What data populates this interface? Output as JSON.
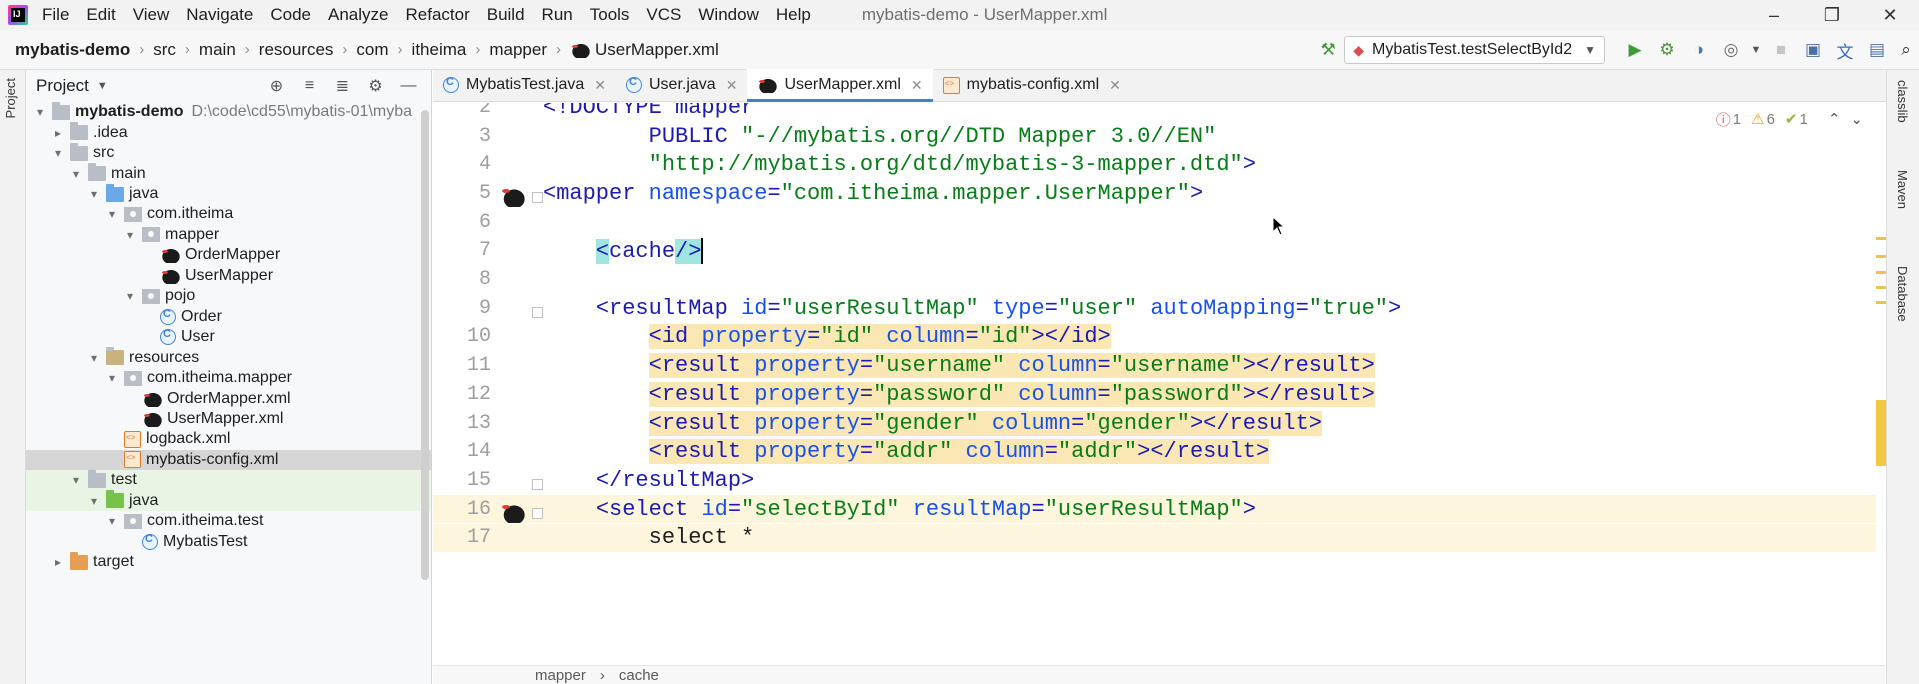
{
  "menubar": {
    "logo_text": "IJ",
    "items": [
      "File",
      "Edit",
      "View",
      "Navigate",
      "Code",
      "Analyze",
      "Refactor",
      "Build",
      "Run",
      "Tools",
      "VCS",
      "Window",
      "Help"
    ],
    "window_title": "mybatis-demo - UserMapper.xml"
  },
  "navbar": {
    "breadcrumb": [
      "mybatis-demo",
      "src",
      "main",
      "resources",
      "com",
      "itheima",
      "mapper",
      "UserMapper.xml"
    ],
    "run_config": "MybatisTest.testSelectById2"
  },
  "left_stripe": {
    "label": "Project"
  },
  "project_panel": {
    "title": "Project",
    "tree": [
      {
        "label": "mybatis-demo",
        "extra": "D:\\code\\cd55\\mybatis-01\\myba",
        "arrow": "▾",
        "icon": "folder",
        "indent": 0,
        "bold": true
      },
      {
        "label": ".idea",
        "arrow": "▸",
        "icon": "folder",
        "indent": 1
      },
      {
        "label": "src",
        "arrow": "▾",
        "icon": "folder",
        "indent": 1
      },
      {
        "label": "main",
        "arrow": "▾",
        "icon": "folder",
        "indent": 2
      },
      {
        "label": "java",
        "arrow": "▾",
        "icon": "folder-blue",
        "indent": 3
      },
      {
        "label": "com.itheima",
        "arrow": "▾",
        "icon": "pkg",
        "indent": 4
      },
      {
        "label": "mapper",
        "arrow": "▾",
        "icon": "pkg",
        "indent": 5
      },
      {
        "label": "OrderMapper",
        "arrow": "",
        "icon": "bird",
        "indent": 6
      },
      {
        "label": "UserMapper",
        "arrow": "",
        "icon": "bird",
        "indent": 6
      },
      {
        "label": "pojo",
        "arrow": "▾",
        "icon": "pkg",
        "indent": 5
      },
      {
        "label": "Order",
        "arrow": "",
        "icon": "cls",
        "indent": 6
      },
      {
        "label": "User",
        "arrow": "",
        "icon": "cls",
        "indent": 6
      },
      {
        "label": "resources",
        "arrow": "▾",
        "icon": "res",
        "indent": 3
      },
      {
        "label": "com.itheima.mapper",
        "arrow": "▾",
        "icon": "pkg",
        "indent": 4
      },
      {
        "label": "OrderMapper.xml",
        "arrow": "",
        "icon": "bird",
        "indent": 5
      },
      {
        "label": "UserMapper.xml",
        "arrow": "",
        "icon": "bird",
        "indent": 5
      },
      {
        "label": "logback.xml",
        "arrow": "",
        "icon": "xml",
        "indent": 4
      },
      {
        "label": "mybatis-config.xml",
        "arrow": "",
        "icon": "xml",
        "indent": 4,
        "selected": true
      },
      {
        "label": "test",
        "arrow": "▾",
        "icon": "folder",
        "indent": 2,
        "test": true
      },
      {
        "label": "java",
        "arrow": "▾",
        "icon": "folder-green",
        "indent": 3,
        "test": true
      },
      {
        "label": "com.itheima.test",
        "arrow": "▾",
        "icon": "pkg",
        "indent": 4
      },
      {
        "label": "MybatisTest",
        "arrow": "",
        "icon": "cls",
        "indent": 5
      },
      {
        "label": "target",
        "arrow": "▸",
        "icon": "folder-orange",
        "indent": 1
      }
    ]
  },
  "tabs": [
    {
      "label": "MybatisTest.java",
      "icon": "cls",
      "active": false
    },
    {
      "label": "User.java",
      "icon": "cls",
      "active": false
    },
    {
      "label": "UserMapper.xml",
      "icon": "bird",
      "active": true
    },
    {
      "label": "mybatis-config.xml",
      "icon": "xml",
      "active": false
    }
  ],
  "inspections": {
    "errors": "1",
    "warnings": "6",
    "weak": "1"
  },
  "code_lines": [
    {
      "n": "2",
      "indent": "",
      "tokens": [
        {
          "c": "t-tag",
          "t": "<!DOCTYPE mapper"
        }
      ]
    },
    {
      "n": "3",
      "indent": "        ",
      "tokens": [
        {
          "c": "t-tag",
          "t": "PUBLIC "
        },
        {
          "c": "t-val",
          "t": "\"-//mybatis.org//DTD Mapper 3.0//EN\""
        }
      ]
    },
    {
      "n": "4",
      "indent": "        ",
      "tokens": [
        {
          "c": "t-val",
          "t": "\"http://mybatis.org/dtd/mybatis-3-mapper.dtd\""
        },
        {
          "c": "t-tag",
          "t": ">"
        }
      ]
    },
    {
      "n": "5",
      "indent": "",
      "gutter": "bird",
      "fold": true,
      "tokens": [
        {
          "c": "t-tag",
          "t": "<mapper "
        },
        {
          "c": "t-attr",
          "t": "namespace"
        },
        {
          "c": "t-tag",
          "t": "="
        },
        {
          "c": "t-val",
          "t": "\"com.itheima.mapper.UserMapper\""
        },
        {
          "c": "t-tag",
          "t": ">"
        }
      ]
    },
    {
      "n": "6",
      "indent": "",
      "tokens": []
    },
    {
      "n": "7",
      "indent": "    ",
      "tokens": [
        {
          "c": "t-tag t-cache",
          "t": "<"
        },
        {
          "c": "t-tag",
          "t": "cache"
        },
        {
          "c": "t-tag t-cache",
          "t": "/>"
        }
      ],
      "caret": true
    },
    {
      "n": "8",
      "indent": "",
      "tokens": []
    },
    {
      "n": "9",
      "indent": "    ",
      "fold": true,
      "tokens": [
        {
          "c": "t-tag",
          "t": "<resultMap "
        },
        {
          "c": "t-attr",
          "t": "id"
        },
        {
          "c": "t-tag",
          "t": "="
        },
        {
          "c": "t-val",
          "t": "\"userResultMap\""
        },
        {
          "c": "t-attr",
          "t": " type"
        },
        {
          "c": "t-tag",
          "t": "="
        },
        {
          "c": "t-val",
          "t": "\"user\""
        },
        {
          "c": "t-attr",
          "t": " autoMapping"
        },
        {
          "c": "t-tag",
          "t": "="
        },
        {
          "c": "t-val",
          "t": "\"true\""
        },
        {
          "c": "t-tag",
          "t": ">"
        }
      ]
    },
    {
      "n": "10",
      "indent": "        ",
      "tokens": [
        {
          "c": "t-tag t-hilite",
          "t": "<id "
        },
        {
          "c": "t-attr t-hilite",
          "t": "property"
        },
        {
          "c": "t-tag t-hilite",
          "t": "="
        },
        {
          "c": "t-val t-hilite",
          "t": "\"id\""
        },
        {
          "c": "t-attr t-hilite",
          "t": " column"
        },
        {
          "c": "t-tag t-hilite",
          "t": "="
        },
        {
          "c": "t-val t-hilite",
          "t": "\"id\""
        },
        {
          "c": "t-tag t-hilite",
          "t": "></id>"
        }
      ]
    },
    {
      "n": "11",
      "indent": "        ",
      "tokens": [
        {
          "c": "t-tag t-hilite",
          "t": "<result "
        },
        {
          "c": "t-attr t-hilite",
          "t": "property"
        },
        {
          "c": "t-tag t-hilite",
          "t": "="
        },
        {
          "c": "t-val t-hilite",
          "t": "\"username\""
        },
        {
          "c": "t-attr t-hilite",
          "t": " column"
        },
        {
          "c": "t-tag t-hilite",
          "t": "="
        },
        {
          "c": "t-val t-hilite",
          "t": "\"username\""
        },
        {
          "c": "t-tag t-hilite",
          "t": "></result>"
        }
      ]
    },
    {
      "n": "12",
      "indent": "        ",
      "tokens": [
        {
          "c": "t-tag t-hilite",
          "t": "<result "
        },
        {
          "c": "t-attr t-hilite",
          "t": "property"
        },
        {
          "c": "t-tag t-hilite",
          "t": "="
        },
        {
          "c": "t-val t-hilite",
          "t": "\"password\""
        },
        {
          "c": "t-attr t-hilite",
          "t": " column"
        },
        {
          "c": "t-tag t-hilite",
          "t": "="
        },
        {
          "c": "t-val t-hilite",
          "t": "\"password\""
        },
        {
          "c": "t-tag t-hilite",
          "t": "></result>"
        }
      ]
    },
    {
      "n": "13",
      "indent": "        ",
      "tokens": [
        {
          "c": "t-tag t-hilite",
          "t": "<result "
        },
        {
          "c": "t-attr t-hilite",
          "t": "property"
        },
        {
          "c": "t-tag t-hilite",
          "t": "="
        },
        {
          "c": "t-val t-hilite",
          "t": "\"gender\""
        },
        {
          "c": "t-attr t-hilite",
          "t": " column"
        },
        {
          "c": "t-tag t-hilite",
          "t": "="
        },
        {
          "c": "t-val t-hilite",
          "t": "\"gender\""
        },
        {
          "c": "t-tag t-hilite",
          "t": "></result>"
        }
      ]
    },
    {
      "n": "14",
      "indent": "        ",
      "tokens": [
        {
          "c": "t-tag t-hilite",
          "t": "<result "
        },
        {
          "c": "t-attr t-hilite",
          "t": "property"
        },
        {
          "c": "t-tag t-hilite",
          "t": "="
        },
        {
          "c": "t-val t-hilite",
          "t": "\"addr\""
        },
        {
          "c": "t-attr t-hilite",
          "t": " column"
        },
        {
          "c": "t-tag t-hilite",
          "t": "="
        },
        {
          "c": "t-val t-hilite",
          "t": "\"addr\""
        },
        {
          "c": "t-tag t-hilite",
          "t": "></result>"
        }
      ]
    },
    {
      "n": "15",
      "indent": "    ",
      "fold": true,
      "tokens": [
        {
          "c": "t-tag",
          "t": "</resultMap>"
        }
      ]
    },
    {
      "n": "16",
      "indent": "    ",
      "gutter": "bird",
      "fold": true,
      "hl": true,
      "tokens": [
        {
          "c": "t-tag",
          "t": "<select "
        },
        {
          "c": "t-attr",
          "t": "id"
        },
        {
          "c": "t-tag",
          "t": "="
        },
        {
          "c": "t-val",
          "t": "\"selectById\""
        },
        {
          "c": "t-attr",
          "t": " resultMap"
        },
        {
          "c": "t-tag",
          "t": "="
        },
        {
          "c": "t-val",
          "t": "\"userResultMap\""
        },
        {
          "c": "t-tag",
          "t": ">"
        }
      ]
    },
    {
      "n": "17",
      "indent": "        ",
      "hl": true,
      "tokens": [
        {
          "c": "t-txt",
          "t": "select *"
        }
      ]
    }
  ],
  "editor_breadcrumb": [
    "mapper",
    "cache"
  ],
  "right_stripe": [
    "classlib",
    "Maven",
    "Database"
  ]
}
